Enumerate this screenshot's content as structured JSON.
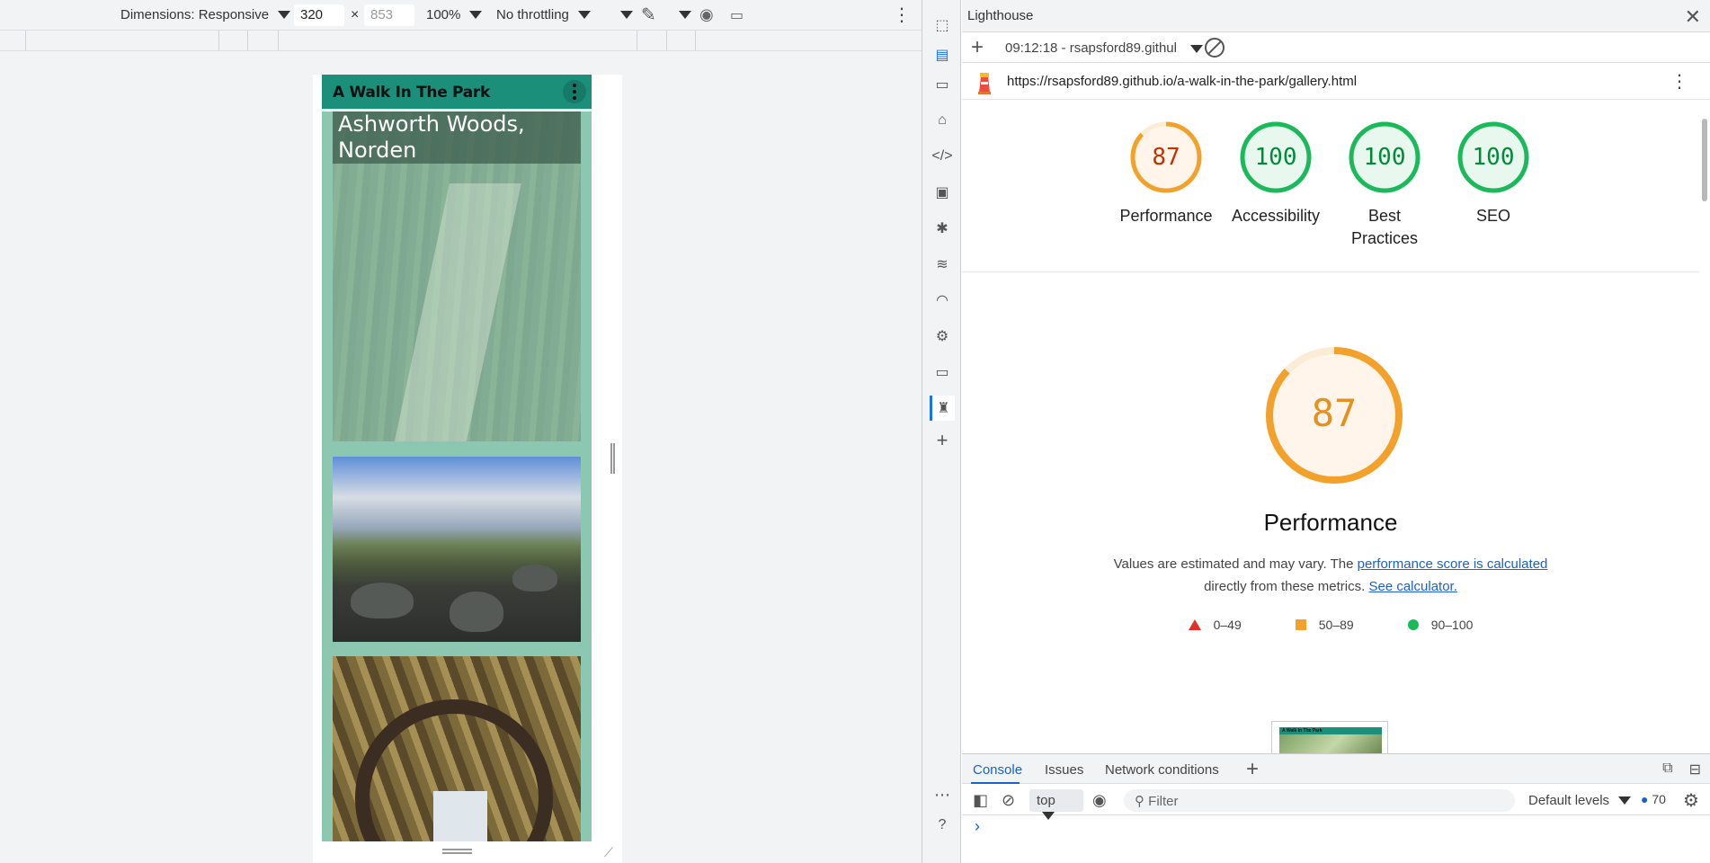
{
  "device_toolbar": {
    "dimensions_label": "Dimensions: Responsive",
    "width_value": "320",
    "times_sign": "×",
    "height_placeholder": "853",
    "zoom": "100%",
    "throttling": "No throttling"
  },
  "site": {
    "brand": "A Walk In The Park",
    "gallery_caption": "Ashworth Woods, Norden"
  },
  "devtools": {
    "panel_title": "Lighthouse",
    "report_name": "09:12:18 - rsapsford89.github",
    "url": "https://rsapsford89.github.io/a-walk-in-the-park/gallery.html"
  },
  "lighthouse": {
    "scores": [
      {
        "label": "Performance",
        "score": "87",
        "status": "average"
      },
      {
        "label": "Accessibility",
        "score": "100",
        "status": "pass"
      },
      {
        "label": "Best Practices",
        "score": "100",
        "status": "pass"
      },
      {
        "label": "SEO",
        "score": "100",
        "status": "pass"
      }
    ],
    "main_score": "87",
    "main_title": "Performance",
    "desc_prefix": "Values are estimated and may vary. The",
    "desc_link": "performance score is calculated",
    "desc_middle": "directly from these metrics.",
    "desc_link2": "See calculator.",
    "legend": {
      "fail": "0–49",
      "average": "50–89",
      "pass": "90–100"
    },
    "thumbnail_text": "A Walk In The Park"
  },
  "drawer": {
    "tabs": [
      "Console",
      "Issues",
      "Network conditions"
    ],
    "context": "top",
    "filter_placeholder": "Filter",
    "levels": "Default levels",
    "message_count": "70"
  },
  "colors": {
    "average": "#f3a12b",
    "pass": "#1ab95a",
    "fail": "#e0302a",
    "site_nav": "#1b8f7a",
    "site_body": "#8cc7b2",
    "link": "#1a62c7"
  }
}
